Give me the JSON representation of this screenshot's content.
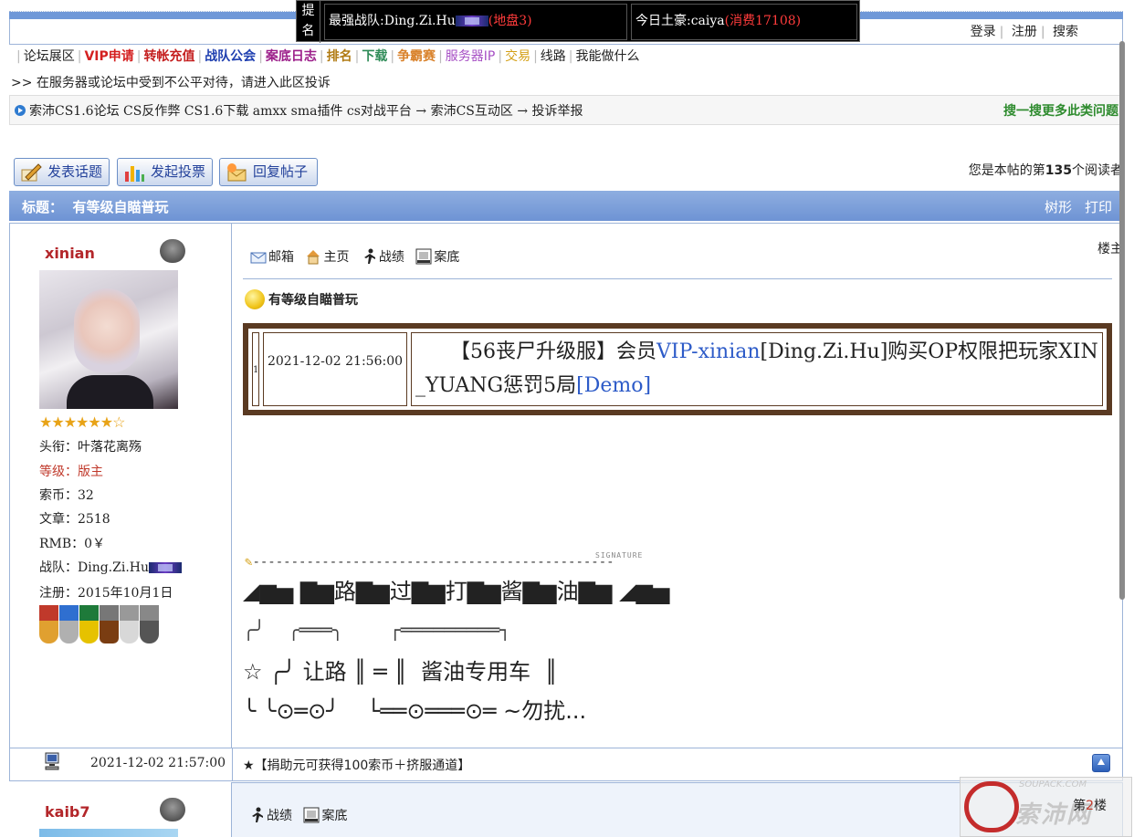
{
  "header": {
    "login_links": [
      "登录",
      "注册",
      "搜索"
    ],
    "rank_banner": {
      "title": "提\n名",
      "strongest_team_label": "最强战队:Ding.Zi.Hu",
      "strongest_team_extra": "(地盘3)",
      "rich_label": "今日土豪:caiya",
      "rich_extra": "(消费17108)"
    }
  },
  "nav": {
    "items": [
      {
        "label": "论坛展区",
        "color": "#222222"
      },
      {
        "label": "VIP申请",
        "color": "#d42020"
      },
      {
        "label": "转帐充值",
        "color": "#c41e1e"
      },
      {
        "label": "战队公会",
        "color": "#1f3fb0"
      },
      {
        "label": "案底日志",
        "color": "#9c1f8a"
      },
      {
        "label": "排名",
        "color": "#b07a12"
      },
      {
        "label": "下载",
        "color": "#2e8b57"
      },
      {
        "label": "争霸赛",
        "color": "#d9822b"
      },
      {
        "label": "服务器IP",
        "color": "#a64fc4"
      },
      {
        "label": "交易",
        "color": "#d4a017"
      },
      {
        "label": "线路",
        "color": "#222222"
      },
      {
        "label": "我能做什么",
        "color": "#222222"
      }
    ],
    "notice": ">> 在服务器或论坛中受到不公平对待，请进入此区投诉"
  },
  "breadcrumb": {
    "text": "索沛CS1.6论坛 CS反作弊 CS1.6下载 amxx sma插件 cs对战平台 → 索沛CS互动区 → 投诉举报",
    "search_more": "搜一搜更多此类问题"
  },
  "actions": {
    "new_topic": "发表话题",
    "new_poll": "发起投票",
    "reply": "回复帖子",
    "reader_count_prefix": "您是本帖的第",
    "reader_count": "135",
    "reader_count_suffix": "个阅读者"
  },
  "thread": {
    "title_label": "标题：",
    "title": "有等级自瞄普玩",
    "tree_view": "树形",
    "print": "打印"
  },
  "post1": {
    "username": "xinian",
    "stars": "★★★★★★☆",
    "profile": {
      "title": "头衔：叶落花离殇",
      "level": "等级：版主",
      "coins": "索币：32",
      "posts": "文章：2518",
      "rmb": "RMB：0￥",
      "team": "战队：Ding.Zi.Hu",
      "registered": "注册：2015年10月1日"
    },
    "floor": "楼主",
    "tools": [
      "邮箱",
      "主页",
      "战绩",
      "案底"
    ],
    "subject": "有等级自瞄普玩",
    "log": {
      "index": "1",
      "date": "2021-12-02 21:56:00",
      "text_prefix": "【56丧尸升级服】会员",
      "vip_user": "VIP-xinian",
      "text_middle": "[Ding.Zi.Hu]购买OP权限把玩家XIN_YUANG惩罚5局",
      "demo": "[Demo]"
    },
    "signature": {
      "rule": "-----------------------------------------------",
      "tag": "SIGNATURE",
      "line1": "◢▆▅ ▇▆路▇▆过▇▆打▇▆酱▇▆油▇▆ ◢▆▅",
      "line2": "╭╯    ╭═══╮        ┌═════════┐",
      "line3": "☆ ╭╯ 让路 ║ ═ ║  酱油专用车  ║",
      "line4": "╰ ╰⊙═⊙╯    └══⊙═══⊙═ ~勿扰..."
    },
    "time": "2021-12-02 21:57:00",
    "donate": "★【捐助元可获得100索币＋挤服通道】"
  },
  "post2": {
    "username": "kaib7",
    "tools": [
      "战绩",
      "案底"
    ],
    "floor": "第2楼",
    "floor_prefix": "第",
    "floor_num": "2",
    "floor_suffix": "楼"
  },
  "watermark": {
    "small": "SOUPACK.COM",
    "big": "索沛网"
  }
}
